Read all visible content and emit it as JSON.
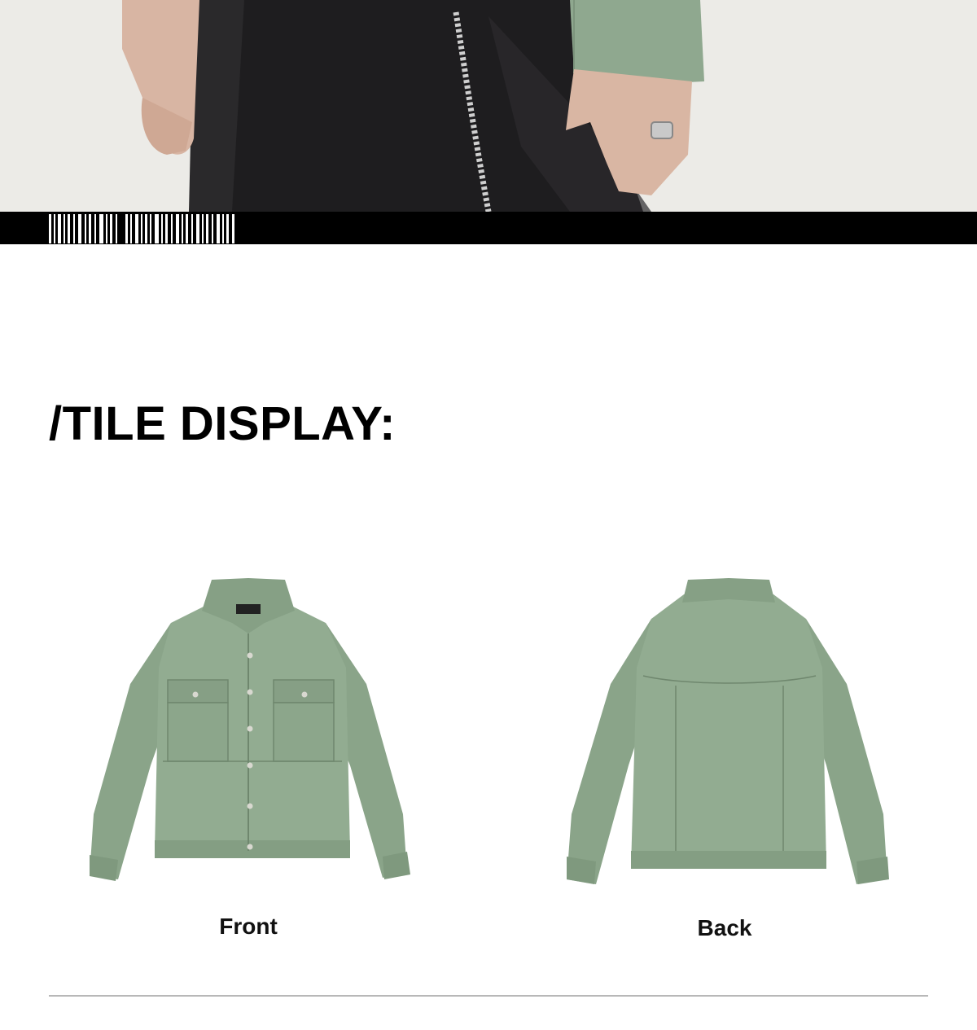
{
  "section": {
    "title": "/TILE DISPLAY:"
  },
  "tiles": [
    {
      "label": "Front",
      "icon": "jacket-front-photo"
    },
    {
      "label": "Back",
      "icon": "jacket-back-photo"
    }
  ],
  "colors": {
    "jacket": "#8fa88f",
    "band": "#000000",
    "divider": "#b8b8b8"
  }
}
